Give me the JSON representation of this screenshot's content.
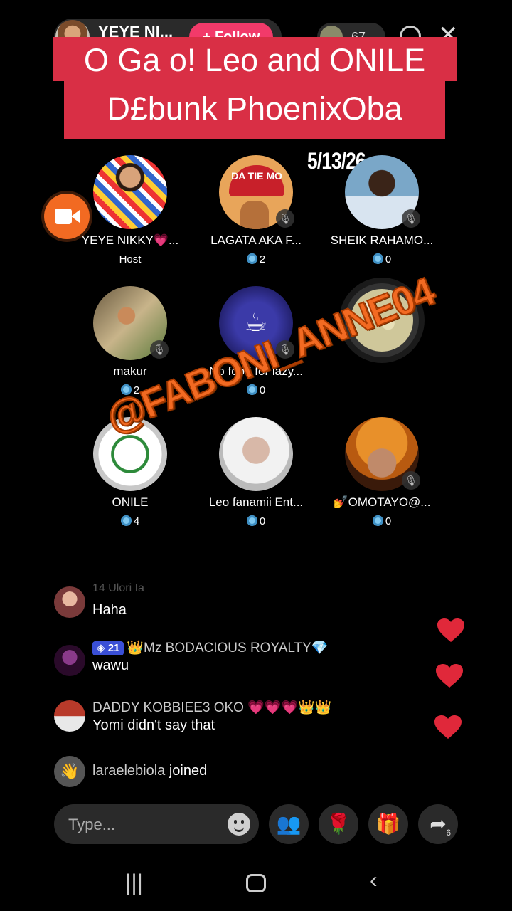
{
  "header": {
    "host_name": "YEYE NI...",
    "follow_label": "+ Follow",
    "viewer_count": "67"
  },
  "overlay": {
    "title_line1": "O Ga o! Leo and ONILE",
    "title_line2": "D£bunk PhoenixOba",
    "date": "5/13/26",
    "watermark": "@FABONI_ANNE04"
  },
  "speakers": [
    {
      "name": "YEYE NIKKY💗...",
      "sub": "Host",
      "is_host": true
    },
    {
      "name": "LAGATA AKA F...",
      "sub": "2",
      "avatar_text": "DA TIE MO"
    },
    {
      "name": "SHEIK RAHAMO...",
      "sub": "0"
    },
    {
      "name": "makur",
      "sub": "2"
    },
    {
      "name": "No food for lazy...",
      "sub": "0"
    },
    {
      "name": "",
      "sub": ""
    },
    {
      "name": "ONILE",
      "sub": "4"
    },
    {
      "name": "Leo fanamii Ent...",
      "sub": "0"
    },
    {
      "name": "💅OMOTAYO@...",
      "sub": "0"
    }
  ],
  "chat": [
    {
      "name": "14 Ulori Ia",
      "text": "Haha"
    },
    {
      "level": "21",
      "name": "👑Mz BODACIOUS ROYALTY💎",
      "text": "wawu"
    },
    {
      "name": "DADDY KOBBIEE3 OKO 💗💗💗👑👑",
      "text": "Yomi didn't say that"
    }
  ],
  "join_event": {
    "user": "laraelebiola",
    "action": "joined"
  },
  "composer": {
    "placeholder": "Type..."
  },
  "share_count": "6",
  "colors": {
    "banner": "#d92f45",
    "watermark": "#f26a22",
    "follow": "#f23a6a",
    "heart": "#e0283a"
  }
}
